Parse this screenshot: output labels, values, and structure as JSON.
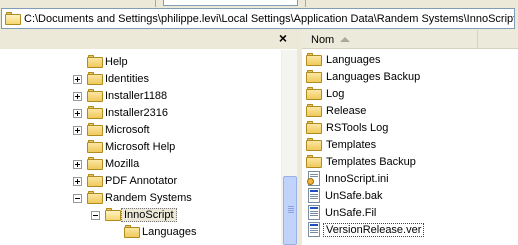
{
  "address_bar": {
    "path": "C:\\Documents and Settings\\philippe.levi\\Local Settings\\Application Data\\Randem Systems\\InnoScript"
  },
  "tree": {
    "close_symbol": "×",
    "items": [
      {
        "label": "Help"
      },
      {
        "label": "Identities"
      },
      {
        "label": "Installer1188"
      },
      {
        "label": "Installer2316"
      },
      {
        "label": "Microsoft"
      },
      {
        "label": "Microsoft Help"
      },
      {
        "label": "Mozilla"
      },
      {
        "label": "PDF Annotator"
      },
      {
        "label": "Randem Systems"
      },
      {
        "label": "InnoScript"
      },
      {
        "label": "Languages"
      }
    ]
  },
  "list": {
    "column_name": "Nom",
    "items": [
      {
        "label": "Languages",
        "icon": "folder-icon"
      },
      {
        "label": "Languages Backup",
        "icon": "folder-icon"
      },
      {
        "label": "Log",
        "icon": "folder-icon"
      },
      {
        "label": "Release",
        "icon": "folder-icon"
      },
      {
        "label": "RSTools Log",
        "icon": "folder-icon"
      },
      {
        "label": "Templates",
        "icon": "folder-icon"
      },
      {
        "label": "Templates Backup",
        "icon": "folder-icon"
      },
      {
        "label": "InnoScript.ini",
        "icon": "ini-file-icon"
      },
      {
        "label": "UnSafe.bak",
        "icon": "file-icon"
      },
      {
        "label": "UnSafe.Fil",
        "icon": "file-icon"
      },
      {
        "label": "VersionRelease.ver",
        "icon": "file-icon"
      }
    ]
  },
  "colors": {
    "window_bg": "#ece9d8",
    "selection_highlight": "#ece9d8",
    "scroll_thumb": "#c1d3fb",
    "folder_yellow": "#f0c95b"
  }
}
